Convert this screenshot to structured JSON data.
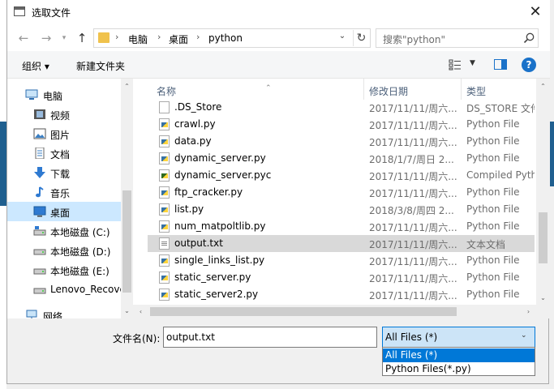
{
  "window": {
    "title": "选取文件"
  },
  "breadcrumb": [
    "电脑",
    "桌面",
    "python"
  ],
  "search": {
    "placeholder": "搜索\"python\""
  },
  "toolbar": {
    "organize": "组织 ▾",
    "new_folder": "新建文件夹"
  },
  "nav_items": [
    {
      "label": "电脑",
      "icon": "computer-icon"
    },
    {
      "label": "视频",
      "icon": "video-icon"
    },
    {
      "label": "图片",
      "icon": "picture-icon"
    },
    {
      "label": "文档",
      "icon": "document-icon"
    },
    {
      "label": "下载",
      "icon": "download-icon"
    },
    {
      "label": "音乐",
      "icon": "music-icon"
    },
    {
      "label": "桌面",
      "icon": "desktop-icon",
      "selected": true
    },
    {
      "label": "本地磁盘 (C:)",
      "icon": "drive-icon"
    },
    {
      "label": "本地磁盘 (D:)",
      "icon": "drive-icon"
    },
    {
      "label": "本地磁盘 (E:)",
      "icon": "drive-icon"
    },
    {
      "label": "Lenovo_Recove",
      "icon": "drive-icon"
    },
    {
      "label": "网络",
      "icon": "network-icon"
    }
  ],
  "columns": {
    "name": "名称",
    "date": "修改日期",
    "type": "类型"
  },
  "files": [
    {
      "name": ".DS_Store",
      "date": "2017/11/11/周六...",
      "type": "DS_STORE 文件",
      "kind": "blank"
    },
    {
      "name": "crawl.py",
      "date": "2017/11/11/周六...",
      "type": "Python File",
      "kind": "py"
    },
    {
      "name": "data.py",
      "date": "2017/11/11/周六...",
      "type": "Python File",
      "kind": "py"
    },
    {
      "name": "dynamic_server.py",
      "date": "2018/1/7/周日 2...",
      "type": "Python File",
      "kind": "py"
    },
    {
      "name": "dynamic_server.pyc",
      "date": "2017/11/11/周六...",
      "type": "Compiled Python",
      "kind": "pyc"
    },
    {
      "name": "ftp_cracker.py",
      "date": "2017/11/11/周六...",
      "type": "Python File",
      "kind": "py"
    },
    {
      "name": "list.py",
      "date": "2018/3/8/周四 2...",
      "type": "Python File",
      "kind": "py"
    },
    {
      "name": "num_matpoltlib.py",
      "date": "2017/11/11/周六...",
      "type": "Python File",
      "kind": "py"
    },
    {
      "name": "output.txt",
      "date": "2017/11/11/周六...",
      "type": "文本文档",
      "kind": "txt",
      "selected": true
    },
    {
      "name": "single_links_list.py",
      "date": "2017/11/11/周六...",
      "type": "Python File",
      "kind": "py"
    },
    {
      "name": "static_server.py",
      "date": "2017/11/11/周六...",
      "type": "Python File",
      "kind": "py"
    },
    {
      "name": "static_server2.py",
      "date": "2017/11/11/周六...",
      "type": "Python File",
      "kind": "py"
    }
  ],
  "filename": {
    "label": "文件名(N):",
    "value": "output.txt"
  },
  "filetype": {
    "selected": "All Files (*)",
    "options": [
      "All Files (*)",
      "Python Files(*.py)"
    ]
  }
}
